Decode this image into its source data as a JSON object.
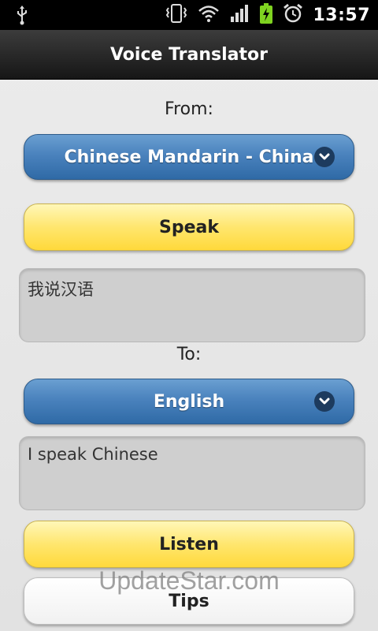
{
  "status_bar": {
    "time": "13:57",
    "icons": [
      "usb-icon",
      "vibrate-icon",
      "wifi-icon",
      "signal-icon",
      "battery-charging-icon",
      "alarm-icon"
    ]
  },
  "app": {
    "title": "Voice Translator"
  },
  "from": {
    "label": "From:",
    "language": "Chinese Mandarin - China",
    "speak_label": "Speak",
    "text": "我说汉语"
  },
  "to": {
    "label": "To:",
    "language": "English",
    "text": "I speak Chinese"
  },
  "actions": {
    "listen_label": "Listen",
    "tips_label": "Tips"
  },
  "watermark": "UpdateStar.com",
  "colors": {
    "select_blue": "#4a82bd",
    "button_yellow": "#ffe66e",
    "battery_green": "#7fd320"
  }
}
